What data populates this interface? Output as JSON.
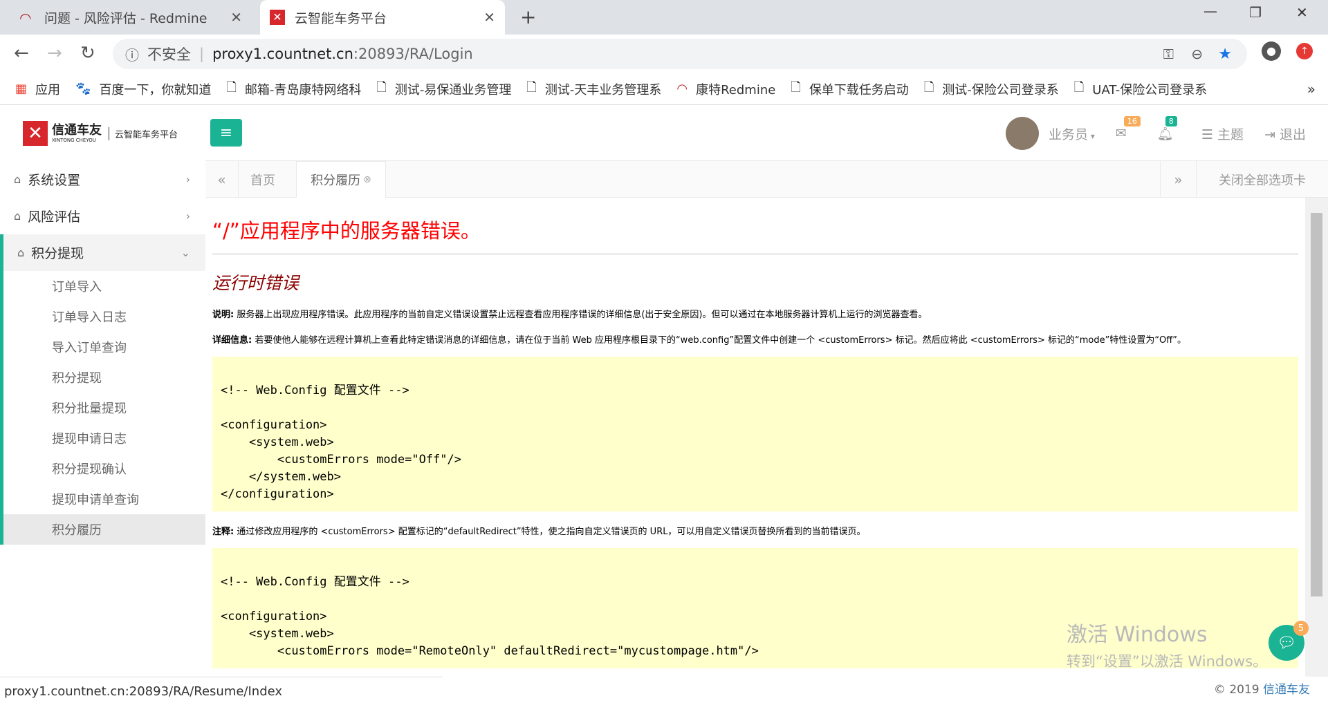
{
  "browser": {
    "tabs": [
      {
        "label": "问题 - 风险评估 - Redmine",
        "active": false
      },
      {
        "label": "云智能车务平台",
        "active": true
      }
    ],
    "security": "不安全",
    "url_host": "proxy1.countnet.cn",
    "url_rest": ":20893/RA/Login",
    "bookmarks": [
      "应用",
      "百度一下，你就知道",
      "邮箱-青岛康特网络科",
      "测试-易保通业务管理",
      "测试-天丰业务管理系",
      "康特Redmine",
      "保单下载任务启动",
      "测试-保险公司登录系",
      "UAT-保险公司登录系"
    ],
    "status_url": "proxy1.countnet.cn:20893/RA/Resume/Index"
  },
  "app": {
    "logo_title": "信通车友",
    "logo_sub": "XINTONG CHEYOU",
    "logo_platform": "云智能车务平台",
    "user": "业务员",
    "msg_count": "16",
    "notif_count": "8",
    "theme": "主题",
    "logout": "退出",
    "menu": [
      {
        "label": "系统设置"
      },
      {
        "label": "风险评估"
      },
      {
        "label": "积分提现"
      }
    ],
    "submenu": [
      "订单导入",
      "订单导入日志",
      "导入订单查询",
      "积分提现",
      "积分批量提现",
      "提现申请日志",
      "积分提现确认",
      "提现申请单查询",
      "积分履历"
    ],
    "page_tabs": {
      "home": "首页",
      "current": "积分履历",
      "close_all": "关闭全部选项卡"
    },
    "copyright_prefix": "© 2019",
    "copyright_brand": "信通车友",
    "chat_badge": "5"
  },
  "error_page": {
    "title": "“/”应用程序中的服务器错误。",
    "subtitle": "运行时错误",
    "desc_label": "说明:",
    "desc_text": "服务器上出现应用程序错误。此应用程序的当前自定义错误设置禁止远程查看应用程序错误的详细信息(出于安全原因)。但可以通过在本地服务器计算机上运行的浏览器查看。",
    "detail_label": "详细信息:",
    "detail_text": "若要使他人能够在远程计算机上查看此特定错误消息的详细信息，请在位于当前 Web 应用程序根目录下的“web.config”配置文件中创建一个 <customErrors> 标记。然后应将此 <customErrors> 标记的“mode”特性设置为“Off”。",
    "code1": "\n<!-- Web.Config 配置文件 -->\n\n<configuration>\n    <system.web>\n        <customErrors mode=\"Off\"/>\n    </system.web>\n</configuration>",
    "note_label": "注释:",
    "note_text": "通过修改应用程序的 <customErrors> 配置标记的“defaultRedirect”特性，使之指向自定义错误页的 URL，可以用自定义错误页替换所看到的当前错误页。",
    "code2": "\n<!-- Web.Config 配置文件 -->\n\n<configuration>\n    <system.web>\n        <customErrors mode=\"RemoteOnly\" defaultRedirect=\"mycustompage.htm\"/>"
  },
  "watermark": {
    "line1": "激活 Windows",
    "line2": "转到“设置”以激活 Windows。"
  }
}
